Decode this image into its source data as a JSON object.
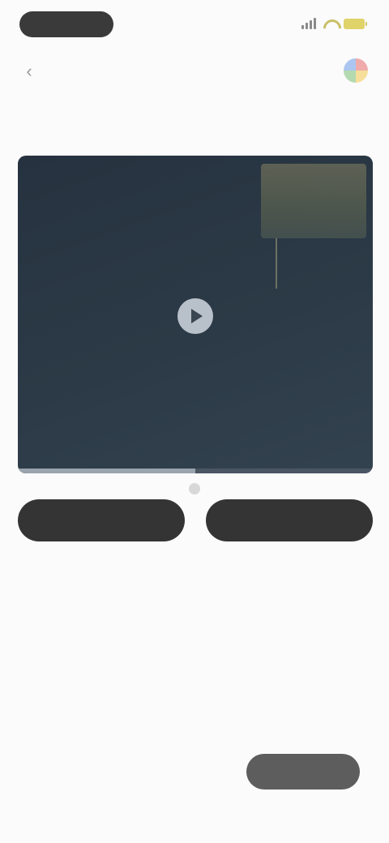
{
  "status_bar": {
    "time": "",
    "icons": [
      "signal-icon",
      "wifi-icon",
      "battery-icon"
    ]
  },
  "header": {
    "title": "",
    "back_icon": "chevron-left-icon",
    "brand_icon": "app-logo-icon"
  },
  "tabs": [
    {
      "label": "",
      "active": false
    },
    {
      "label": "",
      "active": false
    },
    {
      "label": "",
      "active": false
    },
    {
      "label": "",
      "active": false
    },
    {
      "label": "",
      "active": true
    }
  ],
  "video": {
    "overlay_lines": [
      "",
      "",
      ""
    ],
    "progress": 0.5,
    "play_icon": "play-icon"
  },
  "actions": {
    "primary_label": "",
    "secondary_label": ""
  },
  "description": {
    "title": "",
    "body": ""
  },
  "footer": {
    "link_text": "",
    "button_label": ""
  },
  "colors": {
    "background": "#fbfbfb",
    "video_bg": "#2c3a47",
    "button_dark": "#343434",
    "footer_button": "#5d5d5d"
  }
}
